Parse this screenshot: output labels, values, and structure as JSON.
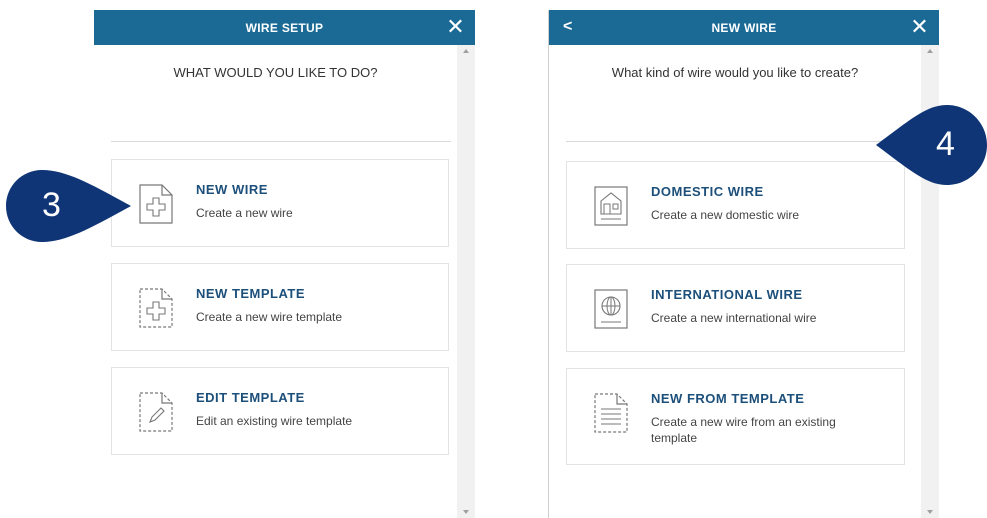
{
  "left_panel": {
    "header_title": "WIRE SETUP",
    "close_glyph": "✕",
    "question": "WHAT WOULD YOU LIKE TO DO?",
    "options": [
      {
        "title": "NEW WIRE",
        "subtitle": "Create a new wire",
        "icon": "new-document-icon"
      },
      {
        "title": "NEW TEMPLATE",
        "subtitle": "Create a new wire template",
        "icon": "new-template-icon"
      },
      {
        "title": "EDIT TEMPLATE",
        "subtitle": "Edit an existing wire template",
        "icon": "edit-template-icon"
      }
    ]
  },
  "right_panel": {
    "header_title": "NEW WIRE",
    "back_glyph": "<",
    "close_glyph": "✕",
    "question": "What kind of wire would you like to create?",
    "options": [
      {
        "title": "DOMESTIC WIRE",
        "subtitle": "Create a new domestic wire",
        "icon": "house-document-icon"
      },
      {
        "title": "INTERNATIONAL WIRE",
        "subtitle": "Create a new international wire",
        "icon": "globe-document-icon"
      },
      {
        "title": "NEW FROM TEMPLATE",
        "subtitle": "Create a new wire from an existing template",
        "icon": "template-list-icon"
      }
    ]
  },
  "callouts": [
    {
      "number": "3"
    },
    {
      "number": "4"
    }
  ],
  "colors": {
    "header": "#1b6a96",
    "title": "#1c4f7a",
    "callout": "#0f3577"
  }
}
